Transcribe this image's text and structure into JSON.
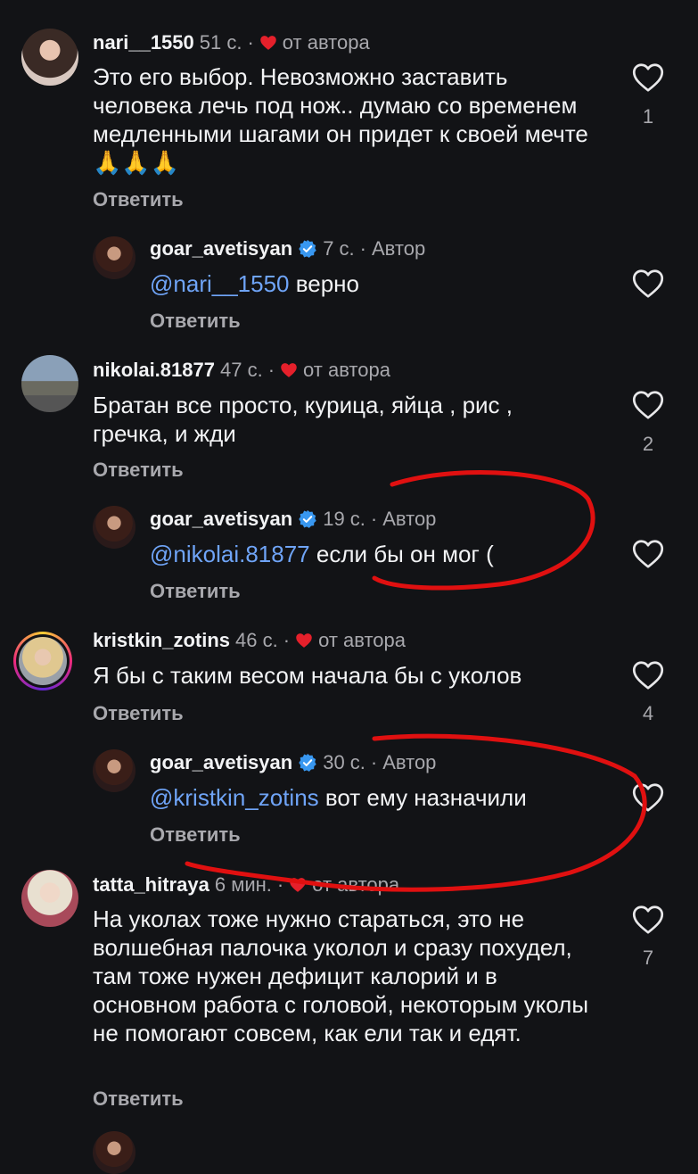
{
  "reply_label": "Ответить",
  "colors": {
    "background": "#121316",
    "mention": "#6fa4f7",
    "heart": "#e5202b",
    "verified": "#3897f0",
    "annotation": "#e01010"
  },
  "comments": [
    {
      "username": "nari__1550",
      "time": "51 с.",
      "author_like": "от автора",
      "text": "Это его выбор. Невозможно заставить человека лечь под нож.. думаю со временем медленными шагами он придет к своей мечте🙏🙏🙏",
      "likes": "1"
    },
    {
      "username": "goar_avetisyan",
      "time": "7 с.",
      "role": "Автор",
      "mention": "@nari__1550",
      "text": " верно"
    },
    {
      "username": "nikolai.81877",
      "time": "47 с.",
      "author_like": "от автора",
      "text": "Братан все просто, курица, яйца , рис , гречка, и жди",
      "likes": "2"
    },
    {
      "username": "goar_avetisyan",
      "time": "19 с.",
      "role": "Автор",
      "mention": "@nikolai.81877",
      "text": " если бы он мог ("
    },
    {
      "username": "kristkin_zotins",
      "time": "46 с.",
      "author_like": "от автора",
      "text": "Я бы с таким весом начала бы с уколов",
      "likes": "4"
    },
    {
      "username": "goar_avetisyan",
      "time": "30 с.",
      "role": "Автор",
      "mention": "@kristkin_zotins",
      "text": " вот ему назначили"
    },
    {
      "username": "tatta_hitraya",
      "time": "6 мин.",
      "author_like": "от автора",
      "text": "На уколах тоже нужно стараться, это не волшебная палочка уколол и сразу похудел, там тоже нужен дефицит калорий и в основном работа с головой, некоторым уколы не помогают совсем, как ели так и едят.",
      "likes": "7"
    }
  ]
}
